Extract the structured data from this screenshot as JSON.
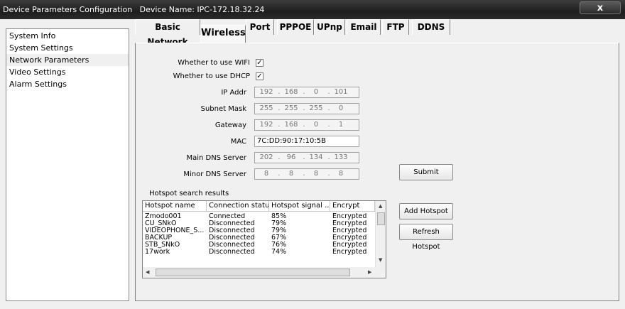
{
  "window": {
    "title": "Device Parameters Configuration   Device Name: IPC-172.18.32.24",
    "close_label": "x"
  },
  "sidebar": {
    "items": [
      {
        "label": "System Info"
      },
      {
        "label": "System Settings"
      },
      {
        "label": "Network Parameters",
        "selected": true
      },
      {
        "label": "Video Settings"
      },
      {
        "label": "Alarm Settings"
      }
    ]
  },
  "tabs": [
    {
      "label": "Basic Network"
    },
    {
      "label": "Wireless",
      "active": true
    },
    {
      "label": "Port"
    },
    {
      "label": "PPPOE"
    },
    {
      "label": "UPnp"
    },
    {
      "label": "Email"
    },
    {
      "label": "FTP"
    },
    {
      "label": "DDNS"
    }
  ],
  "wireless": {
    "use_wifi": {
      "label": "Whether to use WIFI",
      "checked": true
    },
    "use_dhcp": {
      "label": "Whether to use DHCP",
      "checked": true
    },
    "ip_addr": {
      "label": "IP Addr",
      "octets": [
        "192",
        "168",
        "0",
        "101"
      ]
    },
    "subnet_mask": {
      "label": "Subnet Mask",
      "octets": [
        "255",
        "255",
        "255",
        "0"
      ]
    },
    "gateway": {
      "label": "Gateway",
      "octets": [
        "192",
        "168",
        "0",
        "1"
      ]
    },
    "mac": {
      "label": "MAC",
      "value": "7C:DD:90:17:10:5B"
    },
    "main_dns": {
      "label": "Main DNS Server",
      "octets": [
        "202",
        "96",
        "134",
        "133"
      ]
    },
    "minor_dns": {
      "label": "Minor DNS Server",
      "octets": [
        "8",
        "8",
        "8",
        "8"
      ]
    },
    "submit_label": "Submit"
  },
  "hotspots": {
    "title": "Hotspot search results",
    "columns": [
      "Hotspot name",
      "Connection status",
      "Hotspot signal ...",
      "Encrypt"
    ],
    "rows": [
      [
        "Zmodo001",
        "Connected",
        "85%",
        "Encrypted"
      ],
      [
        "CU_SNkO",
        "Disconnected",
        "79%",
        "Encrypted"
      ],
      [
        "VIDEOPHONE_S...",
        "Disconnected",
        "79%",
        "Encrypted"
      ],
      [
        "BACKUP",
        "Disconnected",
        "67%",
        "Encrypted"
      ],
      [
        "STB_SNkO",
        "Disconnected",
        "76%",
        "Encrypted"
      ],
      [
        "17work",
        "Disconnected",
        "74%",
        "Encrypted"
      ]
    ],
    "add_label": "Add Hotspot",
    "refresh_label": "Refresh Hotspot"
  }
}
